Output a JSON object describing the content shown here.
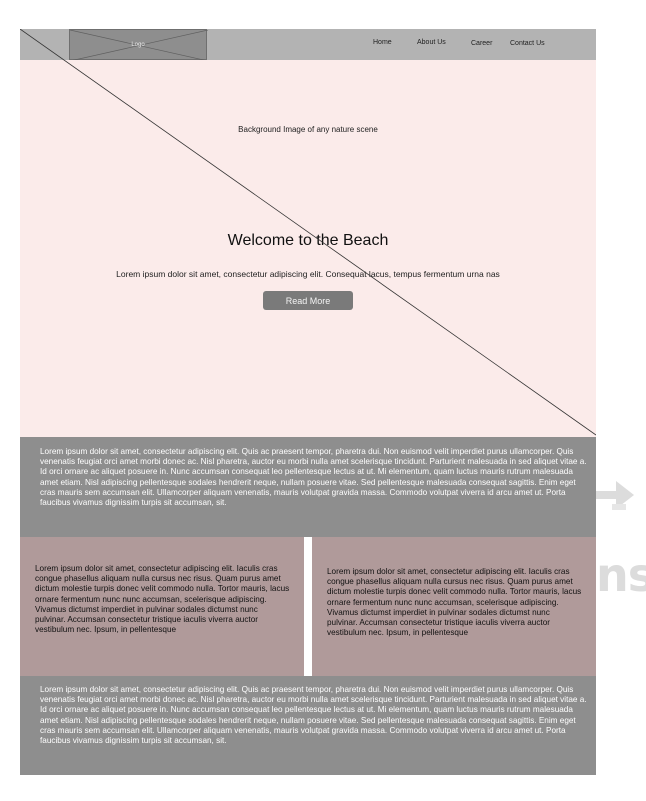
{
  "header": {
    "logo_label": "Logo",
    "nav": [
      "Home",
      "About Us",
      "Career",
      "Contact Us"
    ]
  },
  "hero": {
    "bg_note": "Background Image of any nature scene",
    "title": "Welcome to the Beach",
    "text": "Lorem ipsum dolor sit amet, consectetur adipiscing elit. Consequat lacus, tempus fermentum urna nas",
    "button_label": "Read More"
  },
  "band_top": {
    "text": "Lorem ipsum dolor sit amet, consectetur adipiscing elit. Quis ac praesent tempor, pharetra dui. Non euismod velit imperdiet purus ullamcorper. Quis venenatis feugiat orci amet morbi donec ac. Nisl pharetra, auctor eu morbi nulla amet scelerisque tincidunt. Parturient malesuada in sed aliquet vitae a. Id orci ornare ac aliquet posuere in. Nunc accumsan consequat leo pellentesque lectus at ut. Mi elementum, quam luctus mauris rutrum malesuada amet etiam. Nisl adipiscing pellentesque sodales hendrerit neque, nullam posuere vitae. Sed pellentesque malesuada consequat sagittis. Enim eget cras mauris sem accumsan elit. Ullamcorper aliquam venenatis, mauris volutpat gravida massa. Commodo volutpat viverra id arcu amet ut. Porta faucibus vivamus dignissim turpis sit accumsan, sit."
  },
  "columns": [
    {
      "text": "Lorem ipsum dolor sit amet, consectetur adipiscing elit. Iaculis cras congue phasellus aliquam nulla cursus nec risus. Quam purus amet dictum molestie turpis donec velit commodo nulla. Tortor mauris, lacus ornare fermentum nunc nunc accumsan, scelerisque adipiscing. Vivamus dictumst imperdiet in pulvinar sodales dictumst nunc pulvinar. Accumsan consectetur tristique iaculis viverra auctor vestibulum nec. Ipsum, in pellentesque"
    },
    {
      "text": "Lorem ipsum dolor sit amet, consectetur adipiscing elit. Iaculis cras congue phasellus aliquam nulla cursus nec risus. Quam purus amet dictum molestie turpis donec velit commodo nulla. Tortor mauris, lacus ornare fermentum nunc nunc accumsan, scelerisque adipiscing. Vivamus dictumst imperdiet in pulvinar sodales dictumst nunc pulvinar. Accumsan consectetur tristique iaculis viverra auctor vestibulum nec. Ipsum, in pellentesque"
    }
  ],
  "band_bottom": {
    "text": "Lorem ipsum dolor sit amet, consectetur adipiscing elit. Quis ac praesent tempor, pharetra dui. Non euismod velit imperdiet purus ullamcorper. Quis venenatis feugiat orci amet morbi donec ac. Nisl pharetra, auctor eu morbi nulla amet scelerisque tincidunt. Parturient malesuada in sed aliquet vitae a. Id orci ornare ac aliquet posuere in. Nunc accumsan consequat leo pellentesque lectus at ut. Mi elementum, quam luctus mauris rutrum malesuada amet etiam. Nisl adipiscing pellentesque sodales hendrerit neque, nullam posuere vitae. Sed pellentesque malesuada consequat sagittis. Enim eget cras mauris sem accumsan elit. Ullamcorper aliquam venenatis, mauris volutpat gravida massa. Commodo volutpat viverra id arcu amet ut. Porta faucibus vivamus dignissim turpis sit accumsan, sit."
  },
  "watermark": {
    "text": "ns",
    "icon": "arrow-right-icon"
  },
  "colors": {
    "header_bg": "#b3b3b3",
    "logo_bg": "#8e8e8e",
    "hero_bg": "#fbebea",
    "button_bg": "#7a7a7a",
    "band_bg": "#8e8e8e",
    "column_bg": "#b09a9a"
  }
}
